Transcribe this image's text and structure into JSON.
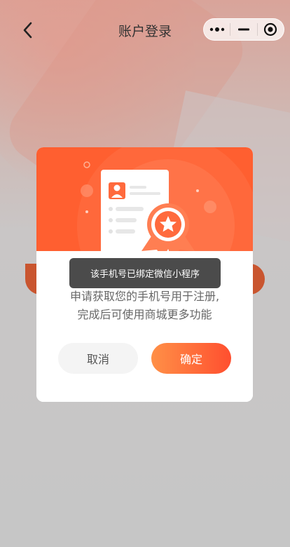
{
  "nav": {
    "title": "账户登录",
    "back_icon": "chevron-left-icon",
    "capsule": {
      "more_icon": "more-dots-icon",
      "minimize_icon": "minimize-icon",
      "close_icon": "target-close-icon"
    }
  },
  "modal": {
    "description_line1": "申请获取您的手机号用于注册,",
    "description_line2": "完成后可使用商城更多功能",
    "cancel_label": "取消",
    "confirm_label": "确定",
    "illustration": "certificate-award-icon"
  },
  "toast": {
    "text": "该手机号已绑定微信小程序"
  },
  "colors": {
    "accent": "#ff5f30",
    "confirm_gradient_start": "#ff9047",
    "confirm_gradient_end": "#ff4f2f",
    "toast_bg": "#4b4b4b"
  }
}
